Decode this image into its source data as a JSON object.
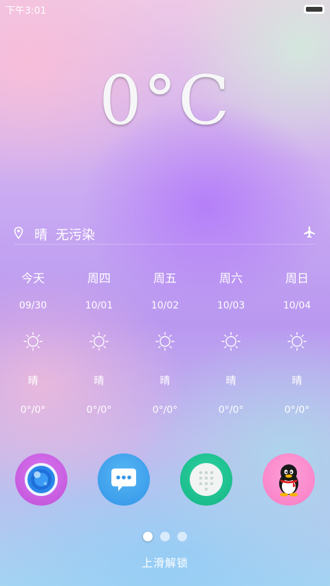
{
  "status_bar": {
    "time": "下午3:01"
  },
  "weather": {
    "temperature": "0°C",
    "condition": "晴",
    "air_quality": "无污染",
    "location_icon": "location-pin-icon",
    "mode_icon": "airplane-icon"
  },
  "forecast": [
    {
      "day": "今天",
      "date": "09/30",
      "icon": "sun-icon",
      "condition": "晴",
      "temp": "0°/0°"
    },
    {
      "day": "周四",
      "date": "10/01",
      "icon": "sun-icon",
      "condition": "晴",
      "temp": "0°/0°"
    },
    {
      "day": "周五",
      "date": "10/02",
      "icon": "sun-icon",
      "condition": "晴",
      "temp": "0°/0°"
    },
    {
      "day": "周六",
      "date": "10/03",
      "icon": "sun-icon",
      "condition": "晴",
      "temp": "0°/0°"
    },
    {
      "day": "周日",
      "date": "10/04",
      "icon": "sun-icon",
      "condition": "晴",
      "temp": "0°/0°"
    }
  ],
  "dock": [
    {
      "name": "camera",
      "icon": "camera-lens-icon",
      "color": "#c04fd8"
    },
    {
      "name": "messages",
      "icon": "message-bubble-icon",
      "color": "#3394e8"
    },
    {
      "name": "dialer",
      "icon": "dialpad-icon",
      "color": "#13b583"
    },
    {
      "name": "qq",
      "icon": "penguin-icon",
      "color": "#f77cc4"
    }
  ],
  "pager": {
    "pages": 3,
    "active": 0
  },
  "unlock_text": "上滑解锁"
}
